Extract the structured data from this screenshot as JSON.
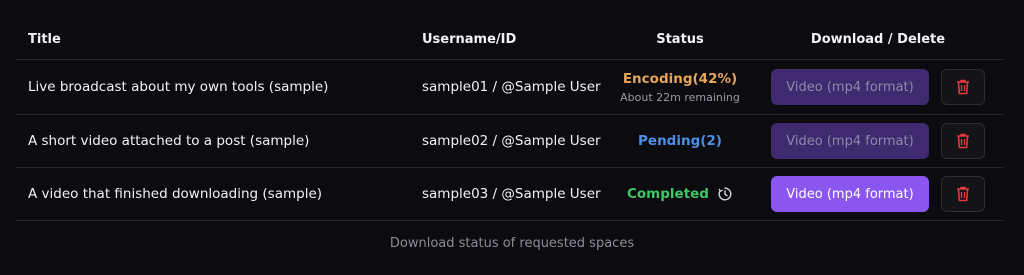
{
  "table": {
    "headers": {
      "title": "Title",
      "username": "Username/ID",
      "status": "Status",
      "actions": "Download / Delete"
    },
    "rows": [
      {
        "title": "Live broadcast about my own tools (sample)",
        "user": "sample01 / @Sample User",
        "status": "Encoding(42%)",
        "status_kind": "encoding",
        "progress_percent": 42,
        "status_sub": "About 22m remaining",
        "video_label": "Video (mp4 format)",
        "video_enabled": false
      },
      {
        "title": "A short video attached to a post (sample)",
        "user": "sample02 / @Sample User",
        "status": "Pending(2)",
        "status_kind": "pending",
        "video_label": "Video (mp4 format)",
        "video_enabled": false
      },
      {
        "title": "A video that finished downloading (sample)",
        "user": "sample03 / @Sample User",
        "status": "Completed",
        "status_kind": "completed",
        "status_icon": "timer-icon",
        "video_label": "Video (mp4 format)",
        "video_enabled": true
      }
    ]
  },
  "footer": "Download status of requested spaces",
  "colors": {
    "encoding": "#e6a55a",
    "pending": "#4d8fe8",
    "completed": "#3ec764",
    "accent": "#8b55f0",
    "delete_icon": "#e23b3b"
  }
}
